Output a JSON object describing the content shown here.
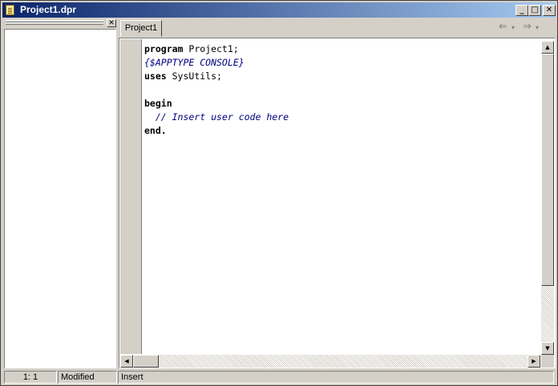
{
  "window": {
    "title": "Project1.dpr",
    "min_glyph": "_",
    "max_glyph": "□",
    "close_glyph": "✕"
  },
  "tabs": [
    {
      "label": "Project1",
      "active": true
    }
  ],
  "nav": {
    "back_glyph": "⇐",
    "back_drop": "▾",
    "forward_glyph": "⇒",
    "forward_drop": "▾"
  },
  "left_pane": {
    "close_glyph": "✕"
  },
  "code": {
    "l1_kw": "program",
    "l1_rest": " Project1;",
    "l2": "{$APPTYPE CONSOLE}",
    "l3_kw": "uses",
    "l3_rest": " SysUtils;",
    "l5_kw": "begin",
    "l6": "  // Insert user code here",
    "l7_kw": "end."
  },
  "scroll": {
    "up": "▲",
    "down": "▼",
    "left": "◀",
    "right": "▶"
  },
  "status": {
    "position": "1:   1",
    "modified": "Modified",
    "mode": "Insert"
  }
}
